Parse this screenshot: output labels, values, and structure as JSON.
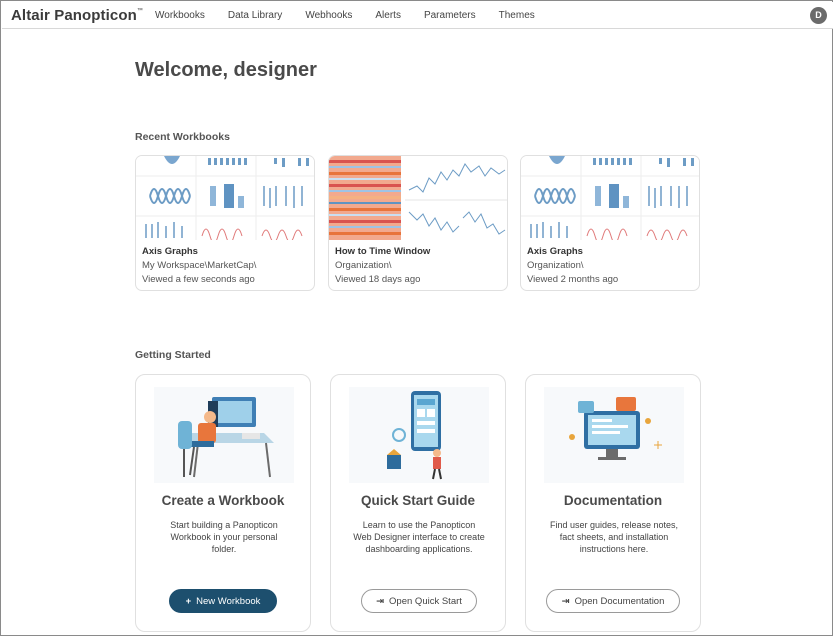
{
  "brand": {
    "name": "Altair Panopticon",
    "tm": "™"
  },
  "nav": [
    "Workbooks",
    "Data Library",
    "Webhooks",
    "Alerts",
    "Parameters",
    "Themes"
  ],
  "user": {
    "initial": "D"
  },
  "welcome": "Welcome, designer",
  "recent": {
    "title": "Recent Workbooks",
    "items": [
      {
        "name": "Axis Graphs",
        "path": "My Workspace\\MarketCap\\",
        "viewed": "Viewed a few seconds ago"
      },
      {
        "name": "How to Time Window",
        "path": "Organization\\",
        "viewed": "Viewed 18 days ago"
      },
      {
        "name": "Axis Graphs",
        "path": "Organization\\",
        "viewed": "Viewed 2 months ago"
      }
    ]
  },
  "getting_started": {
    "title": "Getting Started",
    "cards": [
      {
        "title": "Create a Workbook",
        "desc": "Start building a Panopticon Workbook in your personal folder.",
        "button": "New Workbook",
        "button_icon": "plus-icon"
      },
      {
        "title": "Quick Start Guide",
        "desc": "Learn to use the Panopticon Web Designer interface to create dashboarding applications.",
        "button": "Open Quick Start",
        "button_icon": "open-external-icon"
      },
      {
        "title": "Documentation",
        "desc": "Find user guides, release notes, fact sheets, and installation instructions here.",
        "button": "Open Documentation",
        "button_icon": "open-external-icon"
      }
    ]
  },
  "colors": {
    "primary": "#1d4f6e",
    "chart": "#6d9cc5",
    "accent_red": "#e07a7a"
  }
}
